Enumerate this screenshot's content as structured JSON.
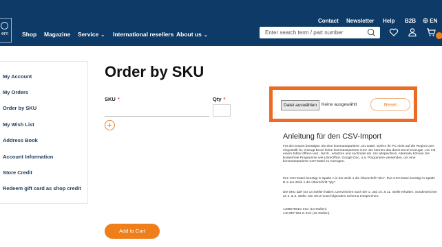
{
  "header": {
    "logo_text": "ern",
    "top_links": [
      "Contact",
      "Newsletter",
      "Help",
      "B2B",
      "EN"
    ],
    "nav": [
      {
        "label": "Shop",
        "dropdown": false
      },
      {
        "label": "Magazine",
        "dropdown": false
      },
      {
        "label": "Service",
        "dropdown": true
      },
      {
        "label": "International resellers",
        "dropdown": false
      },
      {
        "label": "About us",
        "dropdown": true
      }
    ],
    "search_placeholder": "Enter search term / part number"
  },
  "sidebar": {
    "items": [
      "My Account",
      "My Orders",
      "Order by SKU",
      "My Wish List",
      "Address Book",
      "Account Information",
      "Store Credit",
      "Redeem gift card as shop credit"
    ]
  },
  "main": {
    "title": "Order by SKU",
    "sku_label": "SKU",
    "qty_label": "Qty",
    "required_mark": "*",
    "add_to_cart": "Add to Cart"
  },
  "upload": {
    "file_button": "Datei auswählen",
    "no_file": "Keine ausgewählt",
    "reset": "Reset"
  },
  "csv_help": {
    "title": "Anleitung für den CSV-Import",
    "p1": "Für den Import benötigen Sie eine kommaseparierte .csv Datei. Sofern Ihr PC nicht auf die Region USA eingestellt ist, erzeugt Excel keine kommaseparierte CSV. Sie können das durch Excel erzeugte .csv mit einem Editor öffnen und ; durch , ersetzen und nochmals als .csv abspeichern. Alternativ können Sie kostenfreie Programme wie LibreOffice, Google Doc, o.a. Programme verwenden, um eine kommaseparierte CSV-Datei zu erzeugen.",
    "p2": "Ihre CSV-Datei benötigt in Spalte A in der Zeile 1 die Überschrift \"sku\". Ihre CSV-Datei benötigt in Spalte B in der Zeile 1 die Überschrift \"qty\".",
    "p3": "Die SKU darf nur 14 Stellen haben. Leerzeichen nach der 1. und 10. & 11. Stelle erhalten. Sonderzeichen an 2. & 3. Stelle. Die SKU muss folgendem Schema entsprechen:",
    "p4": "1J0857961G 01C (14 Stellen)",
    "p5": "1J0 857 961 G 01C (18 Stellen)"
  },
  "colors": {
    "header_bg": "#0d3a66",
    "accent": "#ee7f1a",
    "highlight_border": "#ec6a23"
  }
}
